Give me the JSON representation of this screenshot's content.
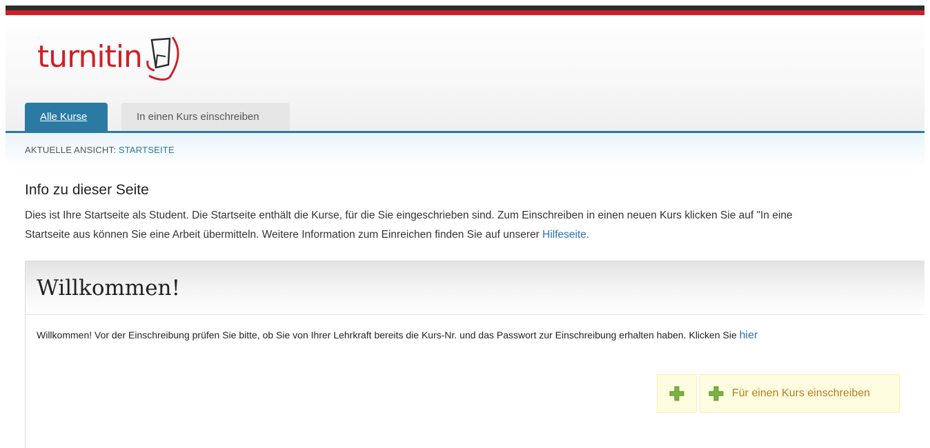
{
  "brand": {
    "logo_text": "turnitin"
  },
  "tabs": [
    {
      "label": "Alle Kurse",
      "active": true
    },
    {
      "label": "In einen Kurs einschreiben",
      "active": false
    }
  ],
  "breadcrumb": {
    "prefix": "AKTUELLE ANSICHT:",
    "current": "STARTSEITE"
  },
  "info": {
    "title": "Info zu dieser Seite",
    "line1": "Dies ist Ihre Startseite als Student. Die Startseite enthält die Kurse, für die Sie eingeschrieben sind. Zum Einschreiben in einen neuen Kurs klicken Sie auf \"In eine",
    "line2": "Startseite aus können Sie eine Arbeit übermitteln. Weitere Information zum Einreichen finden Sie auf unserer",
    "help_link": "Hilfeseite."
  },
  "welcome": {
    "title": "Willkommen!",
    "text": "Willkommen! Vor der Einschreibung prüfen Sie bitte, ob Sie von Ihrer Lehrkraft bereits die Kurs-Nr. und das Passwort zur Einschreibung erhalten haben. Klicken Sie",
    "link": "hier"
  },
  "actions": {
    "enroll_label": "Für einen Kurs einschreiben",
    "icon": "plus-icon"
  },
  "colors": {
    "brand_red": "#d11f26",
    "tab_blue": "#2a7aa3",
    "link_blue": "#2a6fb5",
    "action_text": "#b67d1e",
    "plus_green": "#7bb342"
  }
}
